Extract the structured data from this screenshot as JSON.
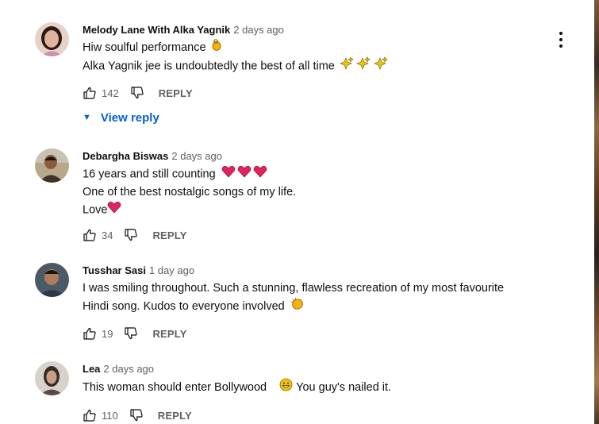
{
  "comments": [
    {
      "author": "Melody Lane With Alka Yagnik",
      "time": "2 days ago",
      "lines": [
        "Hiw soulful performance",
        "Alka Yagnik jee is undoubtedly the best of all time"
      ],
      "likes": "142",
      "reply": "REPLY",
      "view_reply": "View reply",
      "emoji_line1": "ok-hand-emoji",
      "emoji_line2": "sparkles-emoji x3"
    },
    {
      "author": "Debargha Biswas",
      "time": "2 days ago",
      "lines": [
        "16 years and still counting",
        "One of the best nostalgic songs of my life.",
        "Love"
      ],
      "likes": "34",
      "reply": "REPLY",
      "emoji_line1": "red-heart-emoji x3",
      "emoji_line3": "red-heart-emoji"
    },
    {
      "author": "Tusshar Sasi",
      "time": "1 day ago",
      "lines": [
        "I was smiling throughout. Such a stunning, flawless recreation of my most favourite",
        "Hindi song. Kudos to everyone involved"
      ],
      "likes": "19",
      "reply": "REPLY",
      "emoji_line2": "clapping-hands-emoji"
    },
    {
      "author": "Lea",
      "time": "2 days ago",
      "lines": [
        "This woman should enter Bollywood",
        "You guy's nailed it."
      ],
      "likes": "110",
      "reply": "REPLY",
      "emoji_line1": "grinning-face-emoji"
    }
  ],
  "colors": {
    "link": "#065fd4",
    "secondary": "#606060",
    "heart": "#e0245e",
    "emoji_gold": "#f5b400"
  }
}
